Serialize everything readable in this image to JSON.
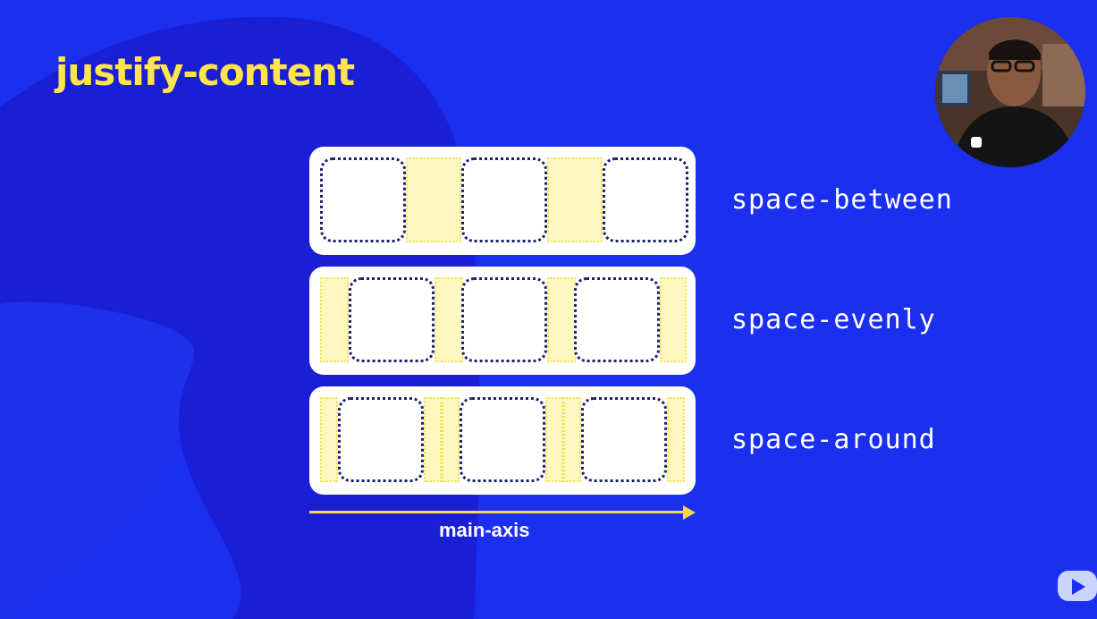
{
  "title": "justify-content",
  "rows": [
    {
      "label": "space-between"
    },
    {
      "label": "space-evenly"
    },
    {
      "label": "space-around"
    }
  ],
  "axis_label": "main-axis",
  "icons": {
    "webcam": "presenter-webcam",
    "logo": "play-logo-icon"
  },
  "colors": {
    "background": "#1a2ff0",
    "title": "#ffe44a",
    "gap_fill": "#fff7c0",
    "item_border": "#1a1f6e",
    "axis": "#f6d84a"
  }
}
